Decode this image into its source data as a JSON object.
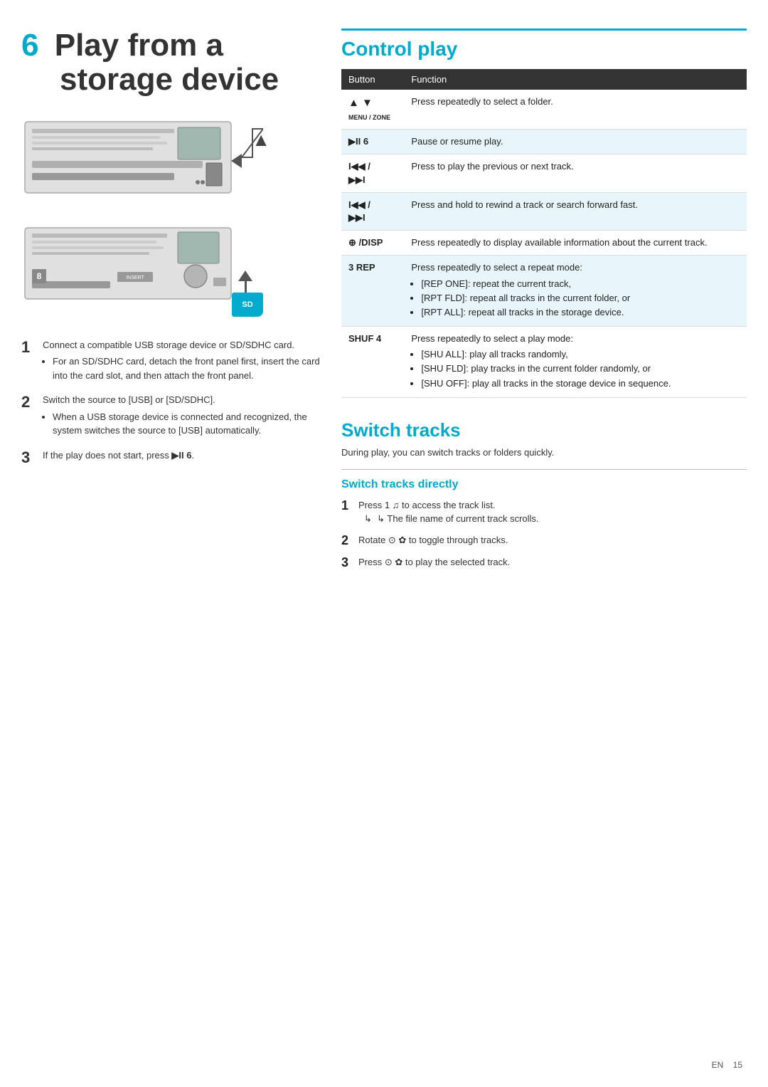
{
  "page": {
    "number": "15",
    "lang": "EN"
  },
  "left": {
    "chapter_num": "6",
    "chapter_title_line1": "Play from a",
    "chapter_title_line2": "storage device",
    "steps": [
      {
        "num": "1",
        "text": "Connect a compatible USB storage device or SD/SDHC card.",
        "bullets": [
          "For an SD/SDHC card, detach the front panel first, insert the card into the card slot, and then attach the front panel."
        ]
      },
      {
        "num": "2",
        "text": "Switch the source to [USB] or [SD/SDHC].",
        "bullets": [
          "When a USB storage device is connected and recognized, the system switches the source to [USB] automatically."
        ]
      },
      {
        "num": "3",
        "text": "If the play does not start, press ▶II 6.",
        "bullets": []
      }
    ]
  },
  "right": {
    "control_play": {
      "title": "Control play",
      "table": {
        "col_button": "Button",
        "col_function": "Function",
        "rows": [
          {
            "button": "▲ ▼\nMENU / ZONE",
            "button_type": "menu-zone",
            "function": "Press repeatedly to select a folder."
          },
          {
            "button": "▶II 6",
            "button_type": "play-pause",
            "function": "Pause or resume play."
          },
          {
            "button": "I◀◀ /\n▶▶I",
            "button_type": "prev-next",
            "function": "Press to play the previous or next track."
          },
          {
            "button": "I◀◀ /\n▶▶I",
            "button_type": "prev-next-hold",
            "function": "Press and hold to rewind a track or search forward fast."
          },
          {
            "button": "⊕ /DISP",
            "button_type": "disp",
            "function": "Press repeatedly to display available information about the current track."
          },
          {
            "button": "3 REP",
            "button_type": "rep",
            "function": "Press repeatedly to select a repeat mode:",
            "sub_bullets": [
              "[REP ONE]: repeat the current track,",
              "[RPT FLD]: repeat all tracks in the current folder, or",
              "[RPT ALL]: repeat all tracks in the storage device."
            ]
          },
          {
            "button": "SHUF 4",
            "button_type": "shuf",
            "function": "Press repeatedly to select a play mode:",
            "sub_bullets": [
              "[SHU ALL]: play all tracks randomly,",
              "[SHU FLD]: play tracks in the current folder randomly, or",
              "[SHU OFF]: play all tracks in the storage device in sequence."
            ]
          }
        ]
      }
    },
    "switch_tracks": {
      "title": "Switch tracks",
      "description": "During play, you can switch tracks or folders quickly.",
      "sub_title": "Switch tracks directly",
      "steps": [
        {
          "num": "1",
          "text": "Press 1 ♫ to access the track list.",
          "sub": "↳  The file name of current track scrolls."
        },
        {
          "num": "2",
          "text": "Rotate ⊙ ✿ to toggle through tracks.",
          "sub": null
        },
        {
          "num": "3",
          "text": "Press ⊙ ✿ to play the selected track.",
          "sub": null
        }
      ]
    }
  }
}
